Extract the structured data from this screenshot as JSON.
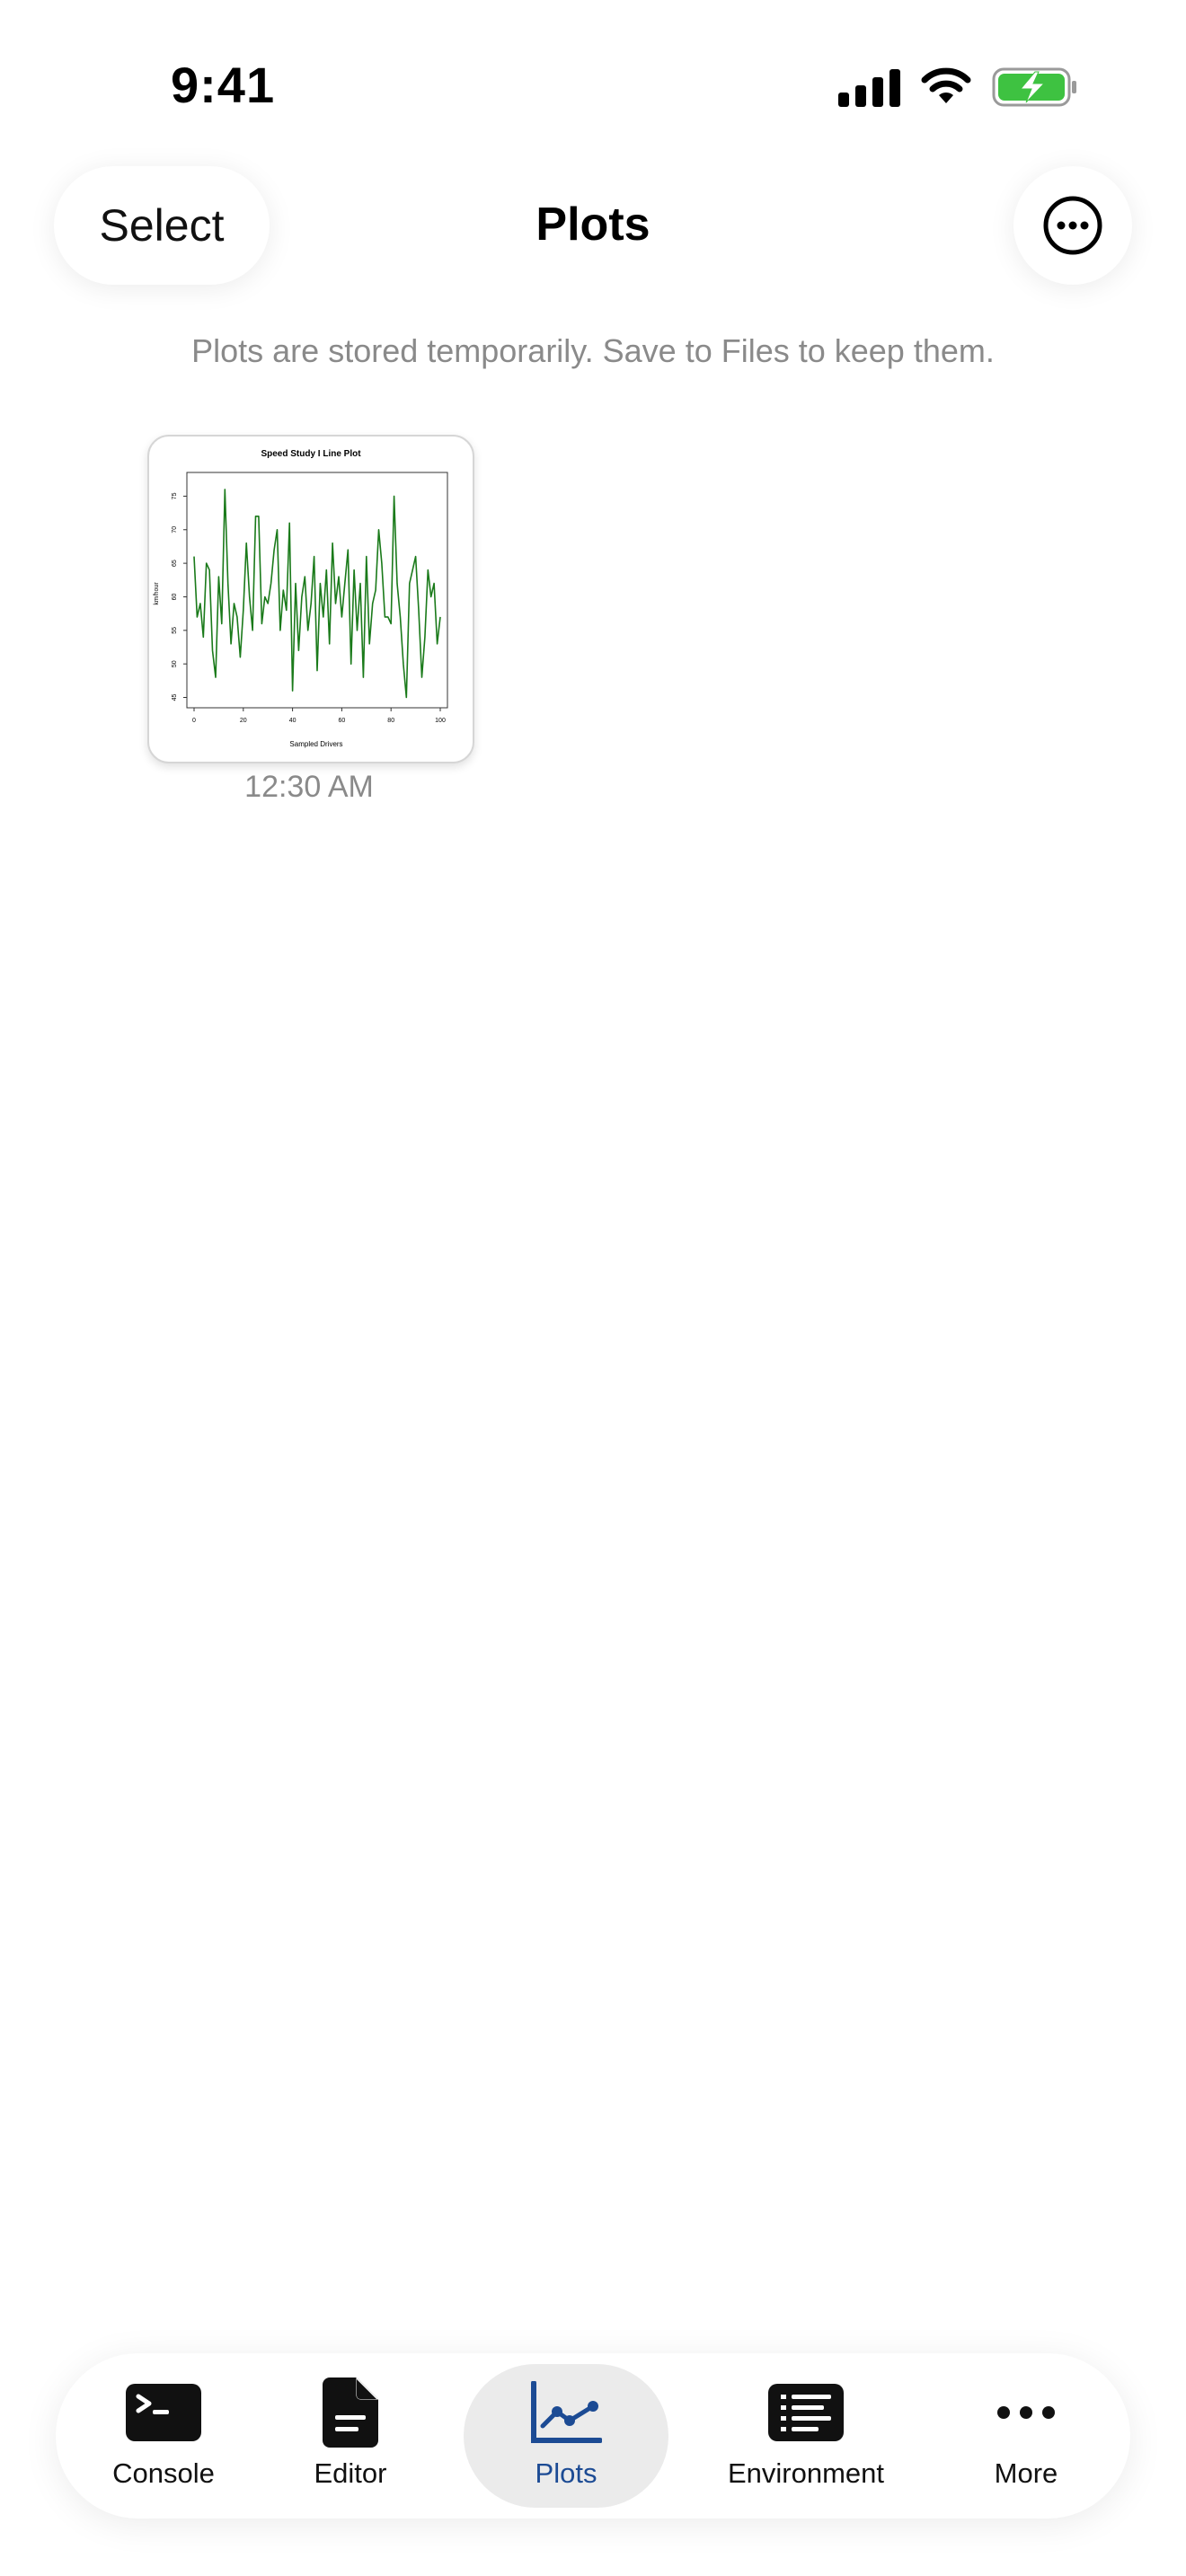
{
  "status_bar": {
    "time": "9:41"
  },
  "header": {
    "select_label": "Select",
    "title": "Plots",
    "more_icon": "ellipsis-circle-icon"
  },
  "notice": "Plots are stored temporarily. Save to Files to keep them.",
  "plots": [
    {
      "time": "12:30 AM",
      "thumbnail": {
        "title": "Speed Study I Line Plot",
        "xlabel": "Sampled Drivers",
        "ylabel": "km/hour",
        "x_ticks": [
          "0",
          "20",
          "40",
          "60",
          "80",
          "100"
        ],
        "y_ticks": [
          "45",
          "50",
          "55",
          "60",
          "65",
          "70",
          "75"
        ]
      }
    }
  ],
  "chart_data": {
    "type": "line",
    "title": "Speed Study I Line Plot",
    "xlabel": "Sampled Drivers",
    "ylabel": "km/hour",
    "xlim": [
      0,
      100
    ],
    "ylim": [
      44,
      78
    ],
    "line_color": "#1a7a1a",
    "x": [
      1,
      2,
      3,
      4,
      5,
      6,
      7,
      8,
      9,
      10,
      11,
      12,
      13,
      14,
      15,
      16,
      17,
      18,
      19,
      20,
      21,
      22,
      23,
      24,
      25,
      26,
      27,
      28,
      29,
      30,
      31,
      32,
      33,
      34,
      35,
      36,
      37,
      38,
      39,
      40,
      41,
      42,
      43,
      44,
      45,
      46,
      47,
      48,
      49,
      50,
      51,
      52,
      53,
      54,
      55,
      56,
      57,
      58,
      59,
      60,
      61,
      62,
      63,
      64,
      65,
      66,
      67,
      68,
      69,
      70,
      71,
      72,
      73,
      74,
      75,
      76,
      77,
      78,
      79,
      80,
      81,
      82,
      83,
      84,
      85,
      86,
      87,
      88,
      89,
      90,
      91,
      92,
      93,
      94,
      95,
      96,
      97,
      98,
      99,
      100
    ],
    "values": [
      66,
      57,
      59,
      54,
      65,
      64,
      52,
      48,
      63,
      56,
      76,
      62,
      53,
      59,
      57,
      51,
      58,
      68,
      60,
      55,
      72,
      72,
      56,
      60,
      59,
      62,
      67,
      70,
      55,
      61,
      58,
      71,
      46,
      62,
      52,
      60,
      63,
      55,
      59,
      66,
      49,
      62,
      57,
      64,
      53,
      68,
      59,
      63,
      57,
      62,
      67,
      50,
      64,
      55,
      62,
      48,
      66,
      53,
      59,
      61,
      70,
      65,
      57,
      57,
      56,
      75,
      62,
      57,
      50,
      45,
      62,
      64,
      66,
      58,
      48,
      54,
      64,
      60,
      62,
      53,
      57
    ],
    "tab_accent": "#1c4b94"
  },
  "tabs": [
    {
      "label": "Console",
      "icon": "terminal-icon",
      "active": false
    },
    {
      "label": "Editor",
      "icon": "document-icon",
      "active": false
    },
    {
      "label": "Plots",
      "icon": "line-chart-icon",
      "active": true
    },
    {
      "label": "Environment",
      "icon": "list-icon",
      "active": false
    },
    {
      "label": "More",
      "icon": "ellipsis-icon",
      "active": false
    }
  ]
}
